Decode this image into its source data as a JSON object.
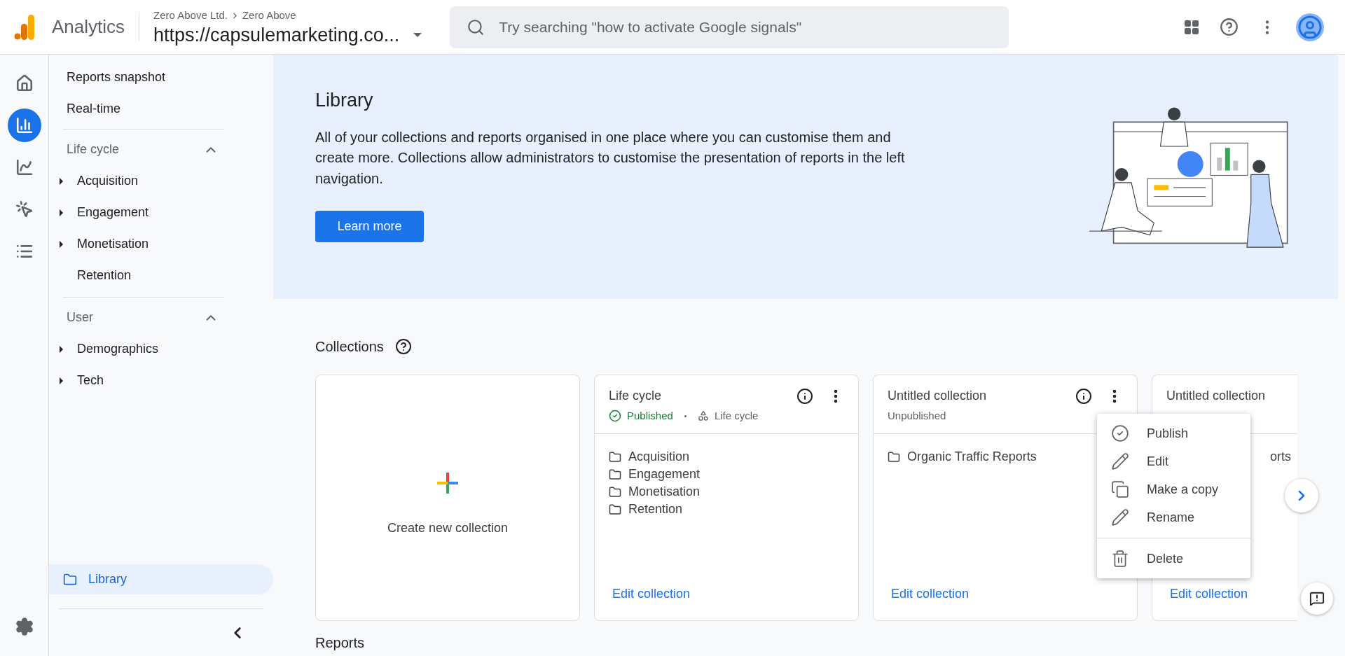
{
  "app": {
    "name": "Analytics"
  },
  "account": {
    "breadcrumb": [
      "Zero Above Ltd.",
      "Zero Above"
    ],
    "property": "https://capsulemarketing.co..."
  },
  "search": {
    "placeholder": "Try searching \"how to activate Google signals\""
  },
  "rail": [
    {
      "kind": "home",
      "selected": false
    },
    {
      "kind": "reports",
      "selected": true
    },
    {
      "kind": "explore",
      "selected": false
    },
    {
      "kind": "advertising",
      "selected": false
    },
    {
      "kind": "configure",
      "selected": false
    }
  ],
  "sidebar": {
    "top_items": [
      "Reports snapshot",
      "Real-time"
    ],
    "sections": [
      {
        "title": "Life cycle",
        "expanded": true,
        "items": [
          {
            "label": "Acquisition",
            "has_children": true
          },
          {
            "label": "Engagement",
            "has_children": true
          },
          {
            "label": "Monetisation",
            "has_children": true
          },
          {
            "label": "Retention",
            "has_children": false
          }
        ]
      },
      {
        "title": "User",
        "expanded": true,
        "items": [
          {
            "label": "Demographics",
            "has_children": true
          },
          {
            "label": "Tech",
            "has_children": true
          }
        ]
      }
    ],
    "library": {
      "label": "Library",
      "selected": true
    }
  },
  "banner": {
    "title": "Library",
    "description": "All of your collections and reports organised in one place where you can customise them and create more. Collections allow administrators to customise the presentation of reports in the left navigation.",
    "button": "Learn more"
  },
  "collections": {
    "title": "Collections",
    "create_label": "Create new collection",
    "cards": [
      {
        "title": "Life cycle",
        "actions": true,
        "menu_open": false,
        "status": {
          "kind": "published",
          "label": "Published"
        },
        "template": "Life cycle",
        "items": [
          "Acquisition",
          "Engagement",
          "Monetisation",
          "Retention"
        ],
        "covered": false,
        "footer": "Edit collection"
      },
      {
        "title": "Untitled collection",
        "actions": true,
        "menu_open": true,
        "status": {
          "kind": "unpublished",
          "label": "Unpublished"
        },
        "items": [
          "Organic Traffic Reports"
        ],
        "covered": false,
        "footer": "Edit collection"
      },
      {
        "title": "Untitled collection",
        "actions": false,
        "menu_open": false,
        "items": [
          "orts"
        ],
        "covered": true,
        "footer": "Edit collection"
      }
    ]
  },
  "menu": {
    "items": [
      {
        "kind": "publish",
        "label": "Publish"
      },
      {
        "kind": "edit",
        "label": "Edit"
      },
      {
        "kind": "copy",
        "label": "Make a copy"
      },
      {
        "kind": "rename",
        "label": "Rename"
      },
      {
        "kind": "delete",
        "label": "Delete",
        "divider_before": true
      }
    ]
  },
  "reports": {
    "title": "Reports"
  }
}
